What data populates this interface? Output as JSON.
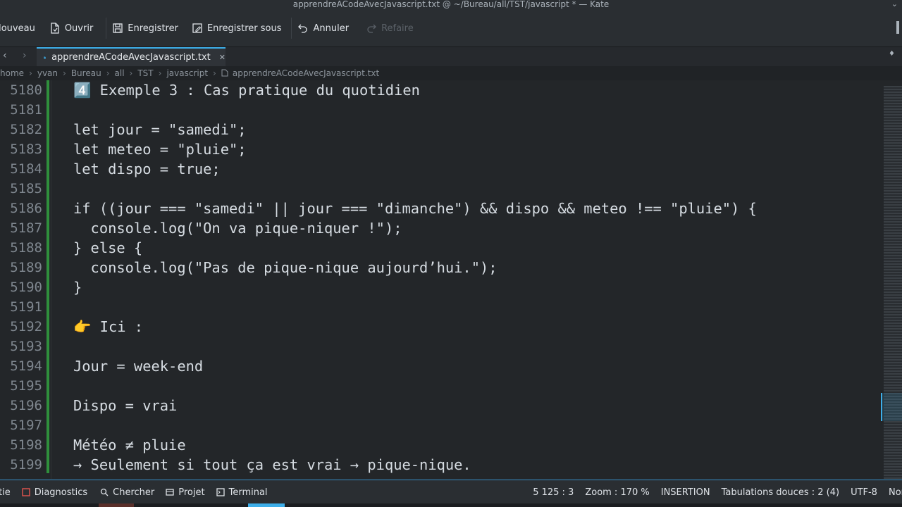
{
  "window": {
    "title": "apprendreACodeAvecJavascript.txt @ ~/Bureau/all/TST/javascript * — Kate"
  },
  "toolbar": {
    "new_label": "Nouveau",
    "open_label": "Ouvrir",
    "save_label": "Enregistrer",
    "save_as_label": "Enregistrer sous",
    "undo_label": "Annuler",
    "redo_label": "Refaire"
  },
  "tabs": [
    {
      "label": "apprendreACodeAvecJavascript.txt",
      "close": "✕"
    }
  ],
  "breadcrumb": [
    "home",
    "yvan",
    "Bureau",
    "all",
    "TST",
    "javascript",
    "apprendreACodeAvecJavascript.txt"
  ],
  "editor": {
    "line_numbers": [
      "5180",
      "5181",
      "5182",
      "5183",
      "5184",
      "5185",
      "5186",
      "5187",
      "5188",
      "5189",
      "5190",
      "5191",
      "5192",
      "5193",
      "5194",
      "5195",
      "5196",
      "5197",
      "5198",
      "5199"
    ],
    "lines": [
      "4️⃣ Exemple 3 : Cas pratique du quotidien",
      "",
      "let jour = \"samedi\";",
      "let meteo = \"pluie\";",
      "let dispo = true;",
      "",
      "if ((jour === \"samedi\" || jour === \"dimanche\") && dispo && meteo !== \"pluie\") {",
      "  console.log(\"On va pique-niquer !\");",
      "} else {",
      "  console.log(\"Pas de pique-nique aujourd’hui.\");",
      "}",
      "",
      "👉 Ici :",
      "",
      "Jour = week-end",
      "",
      "Dispo = vrai",
      "",
      "Météo ≠ pluie",
      "→ Seulement si tout ça est vrai → pique-nique."
    ]
  },
  "statusbar": {
    "left_cut": "tie",
    "diagnostics": "Diagnostics",
    "search": "Chercher",
    "project": "Projet",
    "terminal": "Terminal",
    "cursor": "5 125 : 3",
    "zoom": "Zoom : 170 %",
    "mode": "INSERTION",
    "indent": "Tabulations douces : 2 (4)",
    "encoding": "UTF-8",
    "eol_cut": "Nor"
  },
  "colors": {
    "accent": "#3daee9",
    "modified_line": "#2f8f3c",
    "background": "#232629"
  }
}
